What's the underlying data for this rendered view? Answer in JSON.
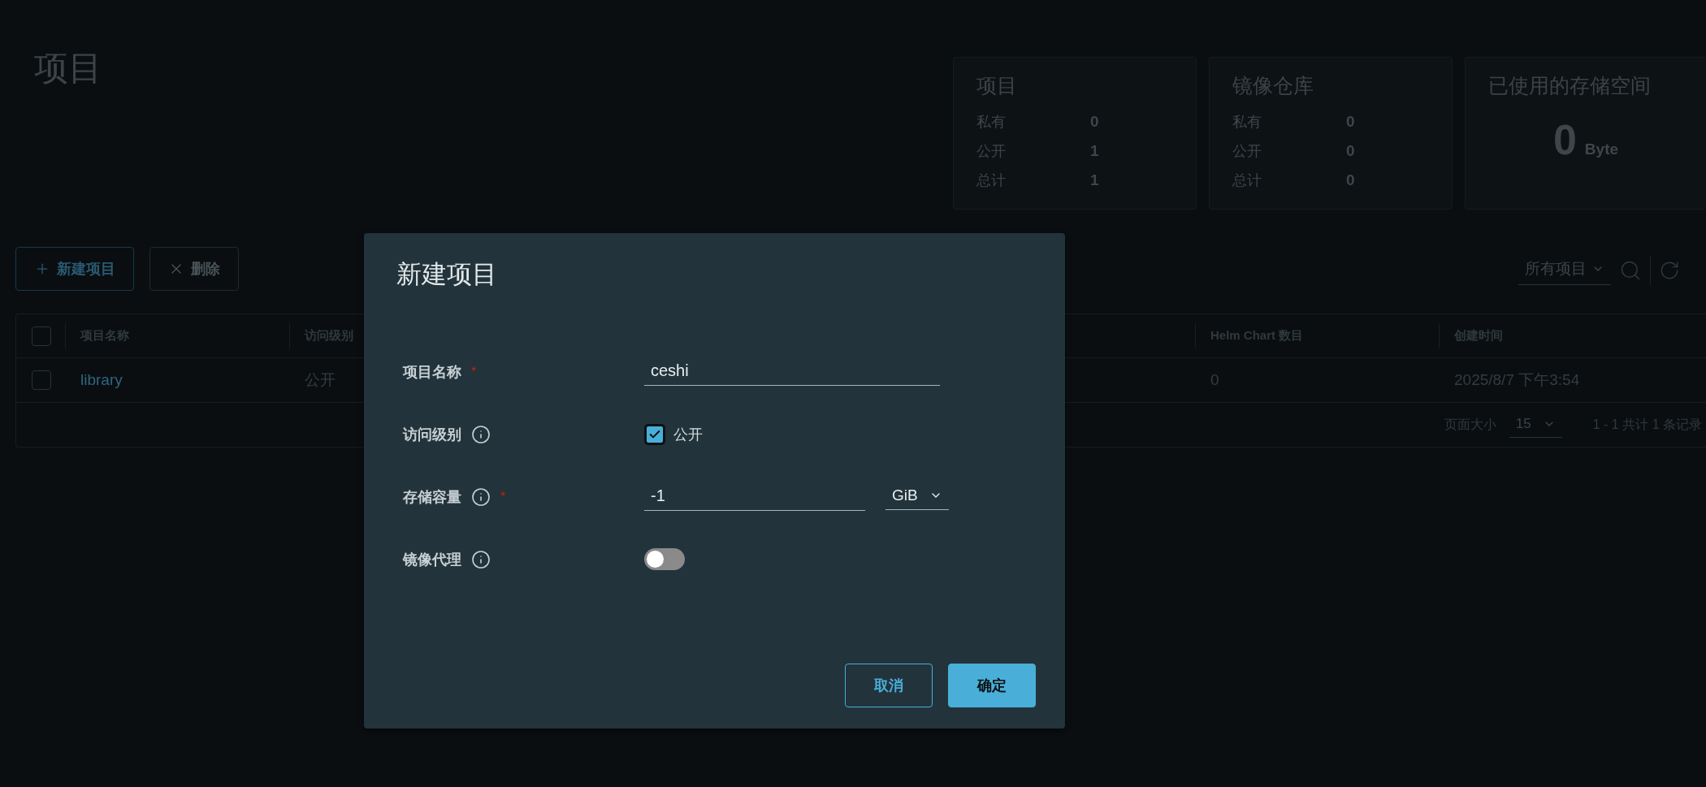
{
  "page": {
    "title": "项目"
  },
  "stats": [
    {
      "kind": "counts",
      "title": "项目",
      "rows": [
        {
          "label": "私有",
          "value": "0"
        },
        {
          "label": "公开",
          "value": "1"
        },
        {
          "label": "总计",
          "value": "1"
        }
      ]
    },
    {
      "kind": "counts",
      "title": "镜像仓库",
      "rows": [
        {
          "label": "私有",
          "value": "0"
        },
        {
          "label": "公开",
          "value": "0"
        },
        {
          "label": "总计",
          "value": "0"
        }
      ]
    },
    {
      "kind": "size",
      "title": "已使用的存储空间",
      "value": "0",
      "unit": "Byte"
    }
  ],
  "toolbar": {
    "buttons": [
      {
        "kind": "add",
        "label": "新建项目",
        "disabled": false
      },
      {
        "kind": "delete",
        "label": "删除",
        "disabled": true
      }
    ],
    "filter": {
      "label": "所有项目"
    }
  },
  "table": {
    "header_checked": false,
    "columns": [
      "项目名称",
      "访问级别",
      "Helm Chart 数目",
      "创建时间"
    ],
    "rows": [
      {
        "checked": false,
        "cells": [
          "library",
          "公开",
          "0",
          "2025/8/7 下午3:54"
        ]
      }
    ],
    "footer": {
      "page_size_label": "页面大小",
      "page_size": "15",
      "summary": "1 - 1 共计 1 条记录"
    }
  },
  "dialog": {
    "title": "新建项目",
    "fields": [
      {
        "kind": "text",
        "label": "项目名称",
        "info": false,
        "required_mark": "*",
        "value": "ceshi"
      },
      {
        "kind": "checkbox",
        "label": "访问级别",
        "info": true,
        "checked": true,
        "option": "公开"
      },
      {
        "kind": "quota",
        "label": "存储容量",
        "info": true,
        "required_mark": "*",
        "value": "-1",
        "unit": "GiB"
      },
      {
        "kind": "toggle",
        "label": "镜像代理",
        "info": true,
        "on": false
      }
    ],
    "buttons": [
      {
        "kind": "outline",
        "label": "取消"
      },
      {
        "kind": "primary",
        "label": "确定"
      }
    ]
  }
}
